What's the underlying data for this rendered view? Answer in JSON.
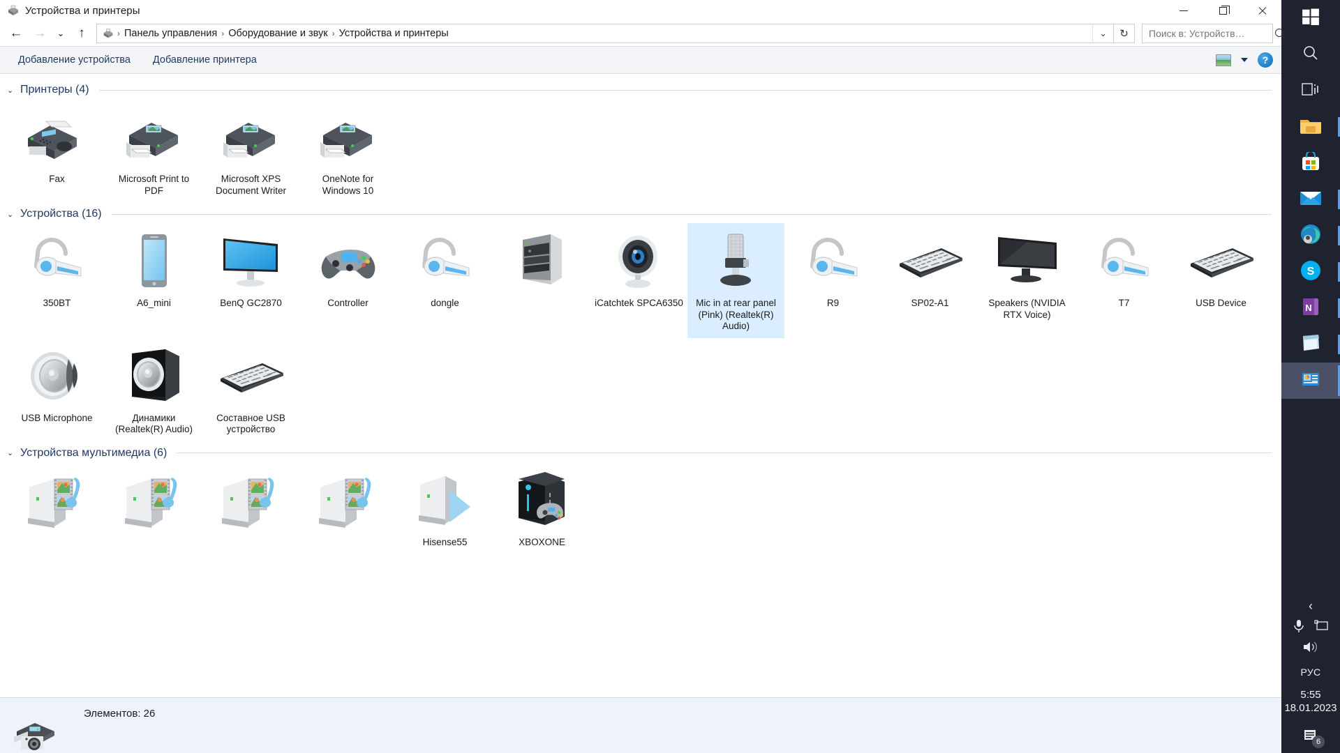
{
  "window": {
    "title": "Устройства и принтеры",
    "title_icon": "devices-printers-icon",
    "minimize_label": "—",
    "maximize_label": "▢",
    "close_label": "✕"
  },
  "navigation": {
    "back_label": "←",
    "forward_label": "→",
    "recent_label": "⌄",
    "up_label": "↑"
  },
  "address": {
    "icon": "devices-printers-icon",
    "crumbs": [
      "Панель управления",
      "Оборудование и звук",
      "Устройства и принтеры"
    ],
    "separator": "›",
    "dropdown_label": "⌄",
    "refresh_label": "↻"
  },
  "search": {
    "value": "",
    "placeholder": "Поиск в: Устройств…",
    "icon": "search-icon"
  },
  "toolbar": {
    "add_device_label": "Добавление устройства",
    "add_printer_label": "Добавление принтера",
    "view_icon": "preview-pane-icon",
    "view_caret": "▾",
    "help_label": "?"
  },
  "sections": [
    {
      "id": "printers",
      "title": "Принтеры (4)",
      "chevron": "⌄",
      "items": [
        {
          "label": "Fax",
          "icon": "fax-icon",
          "selected": false
        },
        {
          "label": "Microsoft Print to PDF",
          "icon": "printer-icon",
          "selected": false
        },
        {
          "label": "Microsoft XPS Document Writer",
          "icon": "printer-icon",
          "selected": false
        },
        {
          "label": "OneNote for Windows 10",
          "icon": "printer-icon",
          "selected": false
        }
      ]
    },
    {
      "id": "devices",
      "title": "Устройства (16)",
      "chevron": "⌄",
      "items": [
        {
          "label": "350BT",
          "icon": "bluetooth-headset-icon",
          "selected": false
        },
        {
          "label": "A6_mini",
          "icon": "smartphone-icon",
          "selected": false
        },
        {
          "label": "BenQ GC2870",
          "icon": "monitor-icon",
          "selected": false
        },
        {
          "label": "Controller",
          "icon": "gamepad-icon",
          "selected": false
        },
        {
          "label": "dongle",
          "icon": "bluetooth-headset-icon",
          "selected": false
        },
        {
          "label": "",
          "icon": "desktop-tower-icon",
          "selected": false
        },
        {
          "label": "iCatchtek SPCA6350",
          "icon": "webcam-icon",
          "selected": false
        },
        {
          "label": "Mic in at rear panel (Pink) (Realtek(R) Audio)",
          "icon": "microphone-icon",
          "selected": true
        },
        {
          "label": "R9",
          "icon": "bluetooth-headset-icon",
          "selected": false
        },
        {
          "label": "SP02-A1",
          "icon": "keyboard-icon",
          "selected": false
        },
        {
          "label": "Speakers (NVIDIA RTX Voice)",
          "icon": "tv-icon",
          "selected": false
        },
        {
          "label": "T7",
          "icon": "bluetooth-headset-icon",
          "selected": false
        },
        {
          "label": "USB Device",
          "icon": "keyboard-icon",
          "selected": false
        },
        {
          "label": "USB Microphone",
          "icon": "speaker-cone-icon",
          "selected": false
        },
        {
          "label": "Динамики (Realtek(R) Audio)",
          "icon": "speaker-box-icon",
          "selected": false
        },
        {
          "label": "Составное USB устройство",
          "icon": "keyboard-icon",
          "selected": false
        }
      ]
    },
    {
      "id": "multimedia",
      "title": "Устройства мультимедиа (6)",
      "chevron": "⌄",
      "items": [
        {
          "label": "",
          "icon": "media-server-icon",
          "selected": false
        },
        {
          "label": "",
          "icon": "media-server-icon",
          "selected": false
        },
        {
          "label": "",
          "icon": "media-server-icon",
          "selected": false
        },
        {
          "label": "",
          "icon": "media-server-icon",
          "selected": false
        },
        {
          "label": "Hisense55",
          "icon": "media-player-icon",
          "selected": false
        },
        {
          "label": "XBOXONE",
          "icon": "xbox-console-icon",
          "selected": false
        }
      ]
    }
  ],
  "statusbar": {
    "icon": "printer-camera-icon",
    "text": "Элементов: 26"
  },
  "taskbar": {
    "items": [
      {
        "name": "start-button",
        "icon": "windows-logo-icon",
        "state": "idle"
      },
      {
        "name": "search-button",
        "icon": "search-icon",
        "state": "idle"
      },
      {
        "name": "task-view-button",
        "icon": "task-view-icon",
        "state": "idle"
      },
      {
        "name": "file-explorer-button",
        "icon": "folder-icon",
        "state": "running"
      },
      {
        "name": "microsoft-store-button",
        "icon": "store-bag-icon",
        "state": "idle"
      },
      {
        "name": "mail-button",
        "icon": "mail-envelope-icon",
        "state": "running"
      },
      {
        "name": "edge-button",
        "icon": "edge-browser-icon",
        "state": "running"
      },
      {
        "name": "skype-button",
        "icon": "skype-icon",
        "state": "running"
      },
      {
        "name": "onenote-button",
        "icon": "onenote-icon",
        "state": "running"
      },
      {
        "name": "sticky-notes-button",
        "icon": "sticky-notes-icon",
        "state": "running"
      },
      {
        "name": "devices-printers-button",
        "icon": "devices-printers-icon",
        "state": "active"
      }
    ],
    "tray": {
      "expand_label": "‹",
      "mic_icon": "microphone-icon",
      "display_icon": "display-icon",
      "volume_icon": "volume-icon",
      "language": "РУС",
      "time": "5:55",
      "date": "18.01.2023",
      "notifications_icon": "notifications-icon",
      "notifications_count": "6"
    }
  },
  "colors": {
    "section_title": "#1f3864",
    "command_link": "#22395e",
    "selection": "#daeeff",
    "taskbar_bg": "#1f2330",
    "accent": "#4ea0ff"
  }
}
